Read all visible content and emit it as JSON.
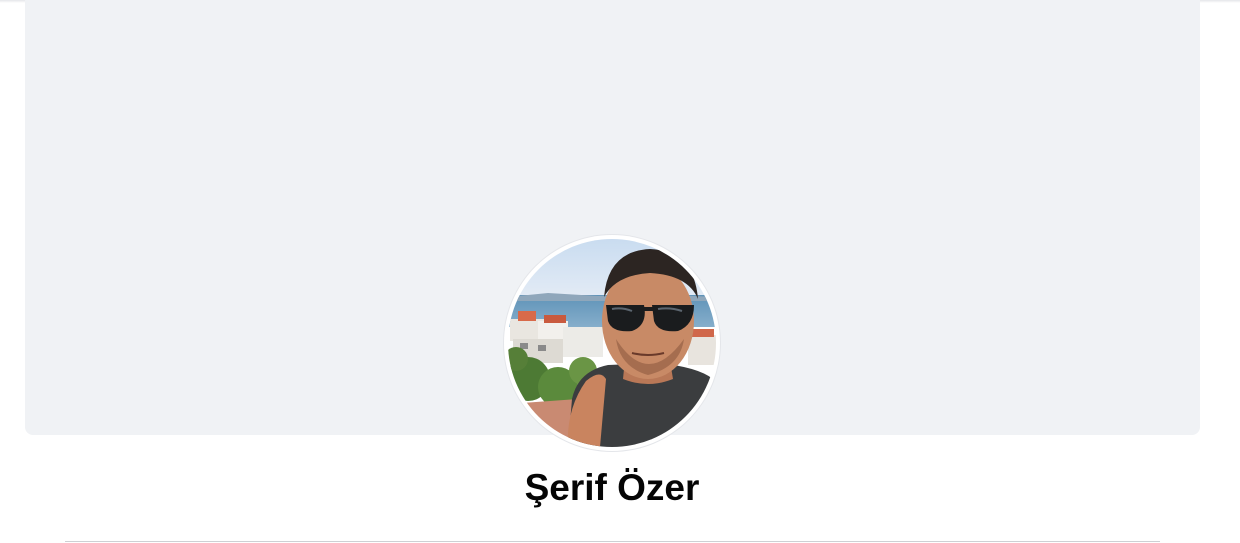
{
  "profile": {
    "name": "Şerif Özer",
    "cover_color": "#f0f2f5",
    "avatar_icon": "profile-photo"
  }
}
